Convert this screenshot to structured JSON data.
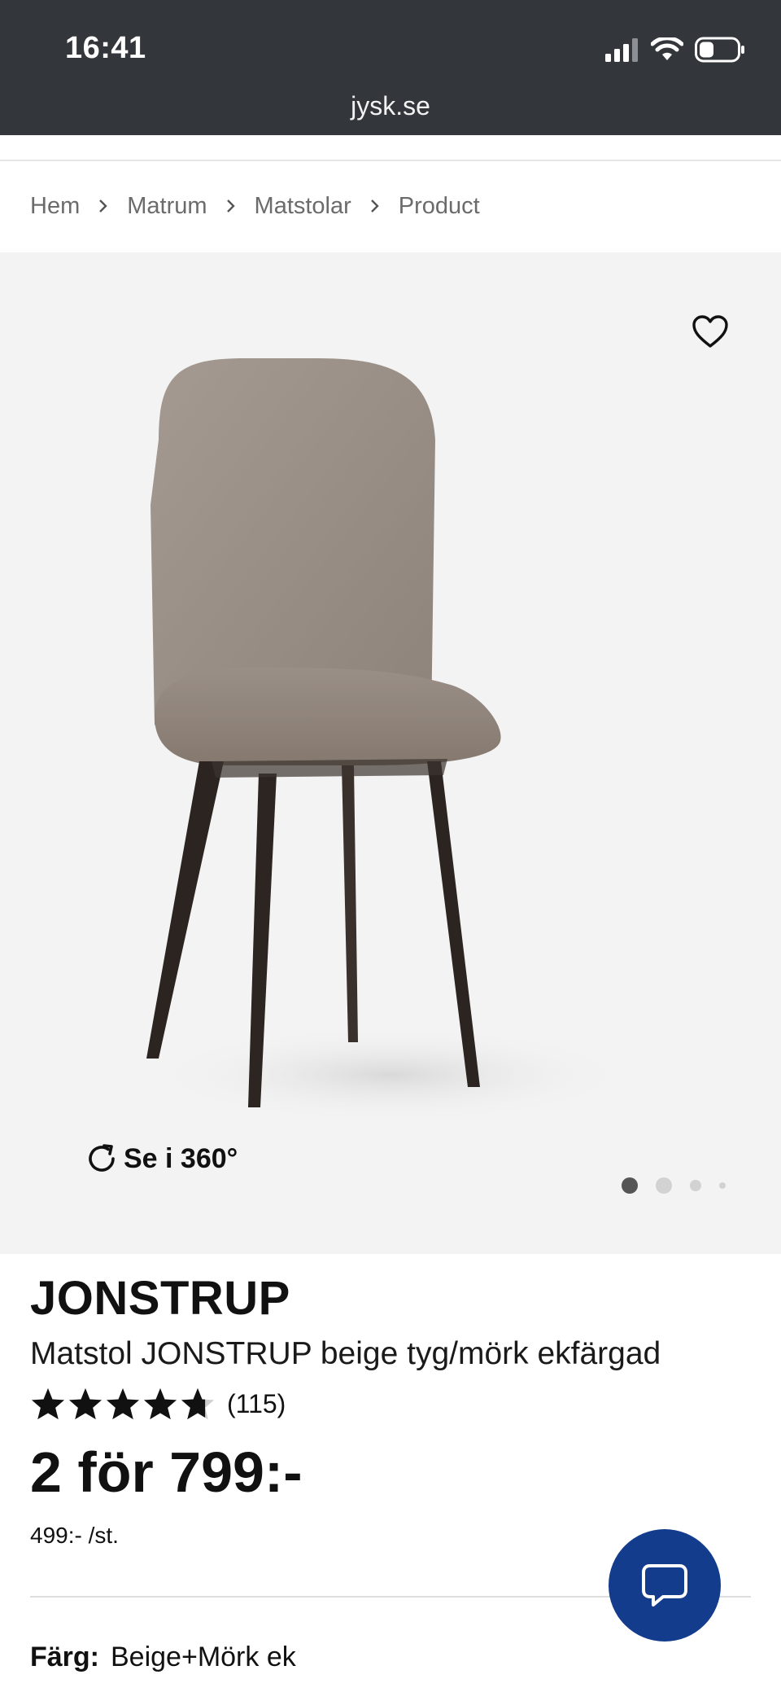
{
  "status_bar": {
    "time": "16:41"
  },
  "browser": {
    "url": "jysk.se"
  },
  "breadcrumb": [
    {
      "label": "Hem"
    },
    {
      "label": "Matrum"
    },
    {
      "label": "Matstolar"
    },
    {
      "label": "Product"
    }
  ],
  "gallery": {
    "spin_label": "Se i 360°",
    "image_count": 4,
    "active_index": 0
  },
  "product": {
    "brand": "JONSTRUP",
    "description": "Matstol JONSTRUP beige tyg/mörk ekfärgad",
    "rating_stars": 4.7,
    "review_count": "(115)",
    "price": "2 för 799:-",
    "unit_price": "499:- /st.",
    "color_label": "Färg:",
    "color_value": "Beige+Mörk ek"
  },
  "colors": {
    "status_bar_bg": "#33363a",
    "gallery_bg": "#f3f3f3",
    "chat_button": "#143c8c",
    "star": "#111111"
  },
  "icons": {
    "favorite": "heart-icon",
    "spin": "rotate-icon",
    "chat": "chat-bubble-icon",
    "separator": "chevron-right-icon"
  }
}
